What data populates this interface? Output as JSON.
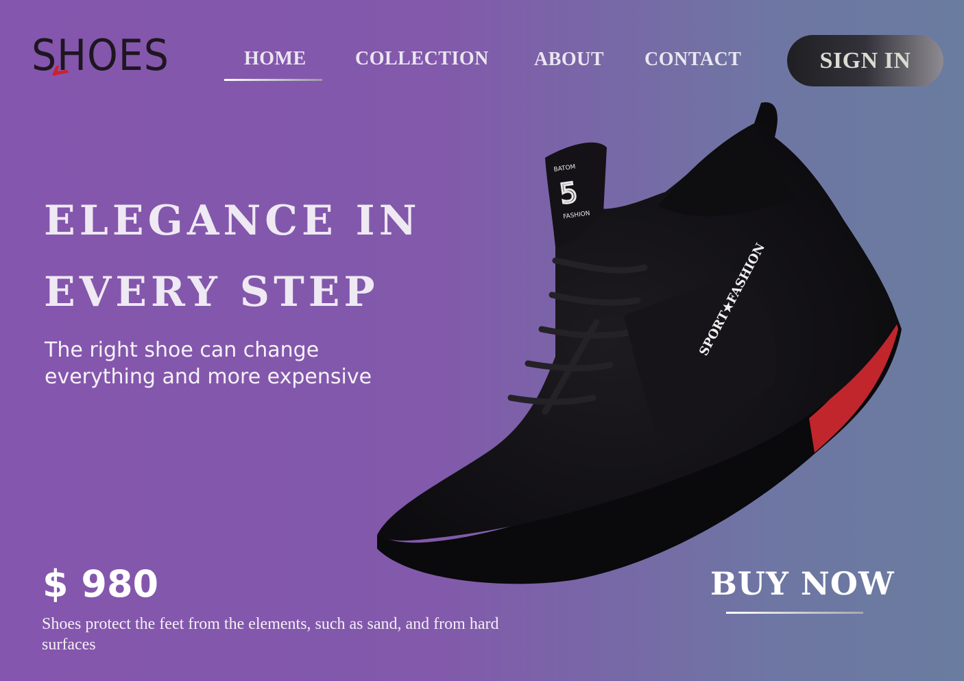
{
  "brand": {
    "logo_text": "SHOES"
  },
  "nav": {
    "items": [
      {
        "label": "HOME",
        "active": true
      },
      {
        "label": "COLLECTION"
      },
      {
        "label": "ABOUT"
      },
      {
        "label": "CONTACT"
      }
    ],
    "sign_in_label": "SIGN IN"
  },
  "hero": {
    "title_line1": "ELEGANCE IN",
    "title_line2": "EVERY STEP",
    "subtitle": "The right shoe can change everything and more expensive"
  },
  "product": {
    "price": "$ 980",
    "description": "Shoes protect the feet from the elements, such as sand, and from hard surfaces",
    "buy_label": "BUY NOW",
    "tongue_label_top": "BATOM",
    "tongue_label_bottom": "FASHION",
    "side_label": "SPORT★FASHION"
  },
  "colors": {
    "bg_left": "#8456ad",
    "bg_right": "#6a7c9f",
    "accent_red": "#c0262c",
    "shoe_black": "#121014"
  }
}
